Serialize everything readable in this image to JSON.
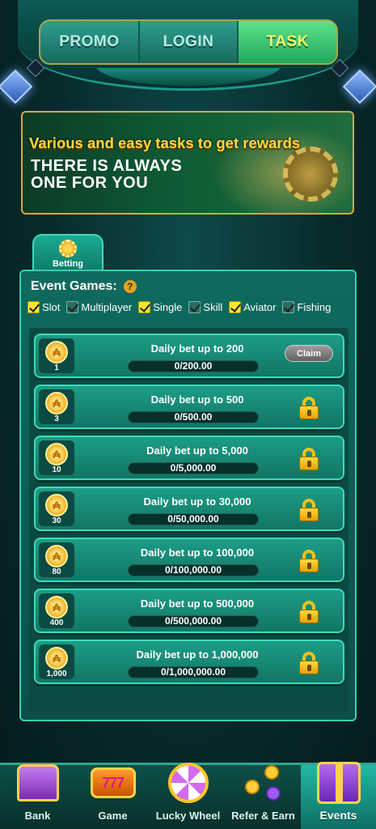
{
  "top_tabs": [
    {
      "label": "PROMO",
      "active": false
    },
    {
      "label": "LOGIN",
      "active": false
    },
    {
      "label": "TASK",
      "active": true
    }
  ],
  "banner": {
    "headline": "Various and easy tasks to get rewards",
    "sub_line1": "THERE IS ALWAYS",
    "sub_line2": "ONE FOR YOU"
  },
  "category_tab": {
    "label": "Betting",
    "icon": "chip-icon"
  },
  "panel": {
    "title": "Event Games:",
    "help_icon": "?",
    "filters": [
      {
        "label": "Slot",
        "checked": true
      },
      {
        "label": "Multiplayer",
        "checked": false
      },
      {
        "label": "Single",
        "checked": true
      },
      {
        "label": "Skill",
        "checked": false
      },
      {
        "label": "Aviator",
        "checked": true
      },
      {
        "label": "Fishing",
        "checked": false
      }
    ]
  },
  "tasks": [
    {
      "reward": "1",
      "title": "Daily bet up to 200",
      "progress": "0/200.00",
      "action": "Claim",
      "locked": false
    },
    {
      "reward": "3",
      "title": "Daily bet up to 500",
      "progress": "0/500.00",
      "locked": true
    },
    {
      "reward": "10",
      "title": "Daily bet up to 5,000",
      "progress": "0/5,000.00",
      "locked": true
    },
    {
      "reward": "30",
      "title": "Daily bet up to 30,000",
      "progress": "0/50,000.00",
      "locked": true
    },
    {
      "reward": "80",
      "title": "Daily bet up to 100,000",
      "progress": "0/100,000.00",
      "locked": true
    },
    {
      "reward": "400",
      "title": "Daily bet up to 500,000",
      "progress": "0/500,000.00",
      "locked": true
    },
    {
      "reward": "1,000",
      "title": "Daily bet up to 1,000,000",
      "progress": "0/1,000,000.00",
      "locked": true
    }
  ],
  "bottom_nav": [
    {
      "label": "Bank",
      "icon": "bank-icon",
      "active": false
    },
    {
      "label": "Game",
      "icon": "slot-machine-icon",
      "slot_text": "777",
      "active": false
    },
    {
      "label": "Lucky Wheel",
      "icon": "wheel-icon",
      "active": false
    },
    {
      "label": "Refer & Earn",
      "icon": "refer-icon",
      "active": false
    },
    {
      "label": "Events",
      "icon": "gift-icon",
      "active": true
    }
  ]
}
